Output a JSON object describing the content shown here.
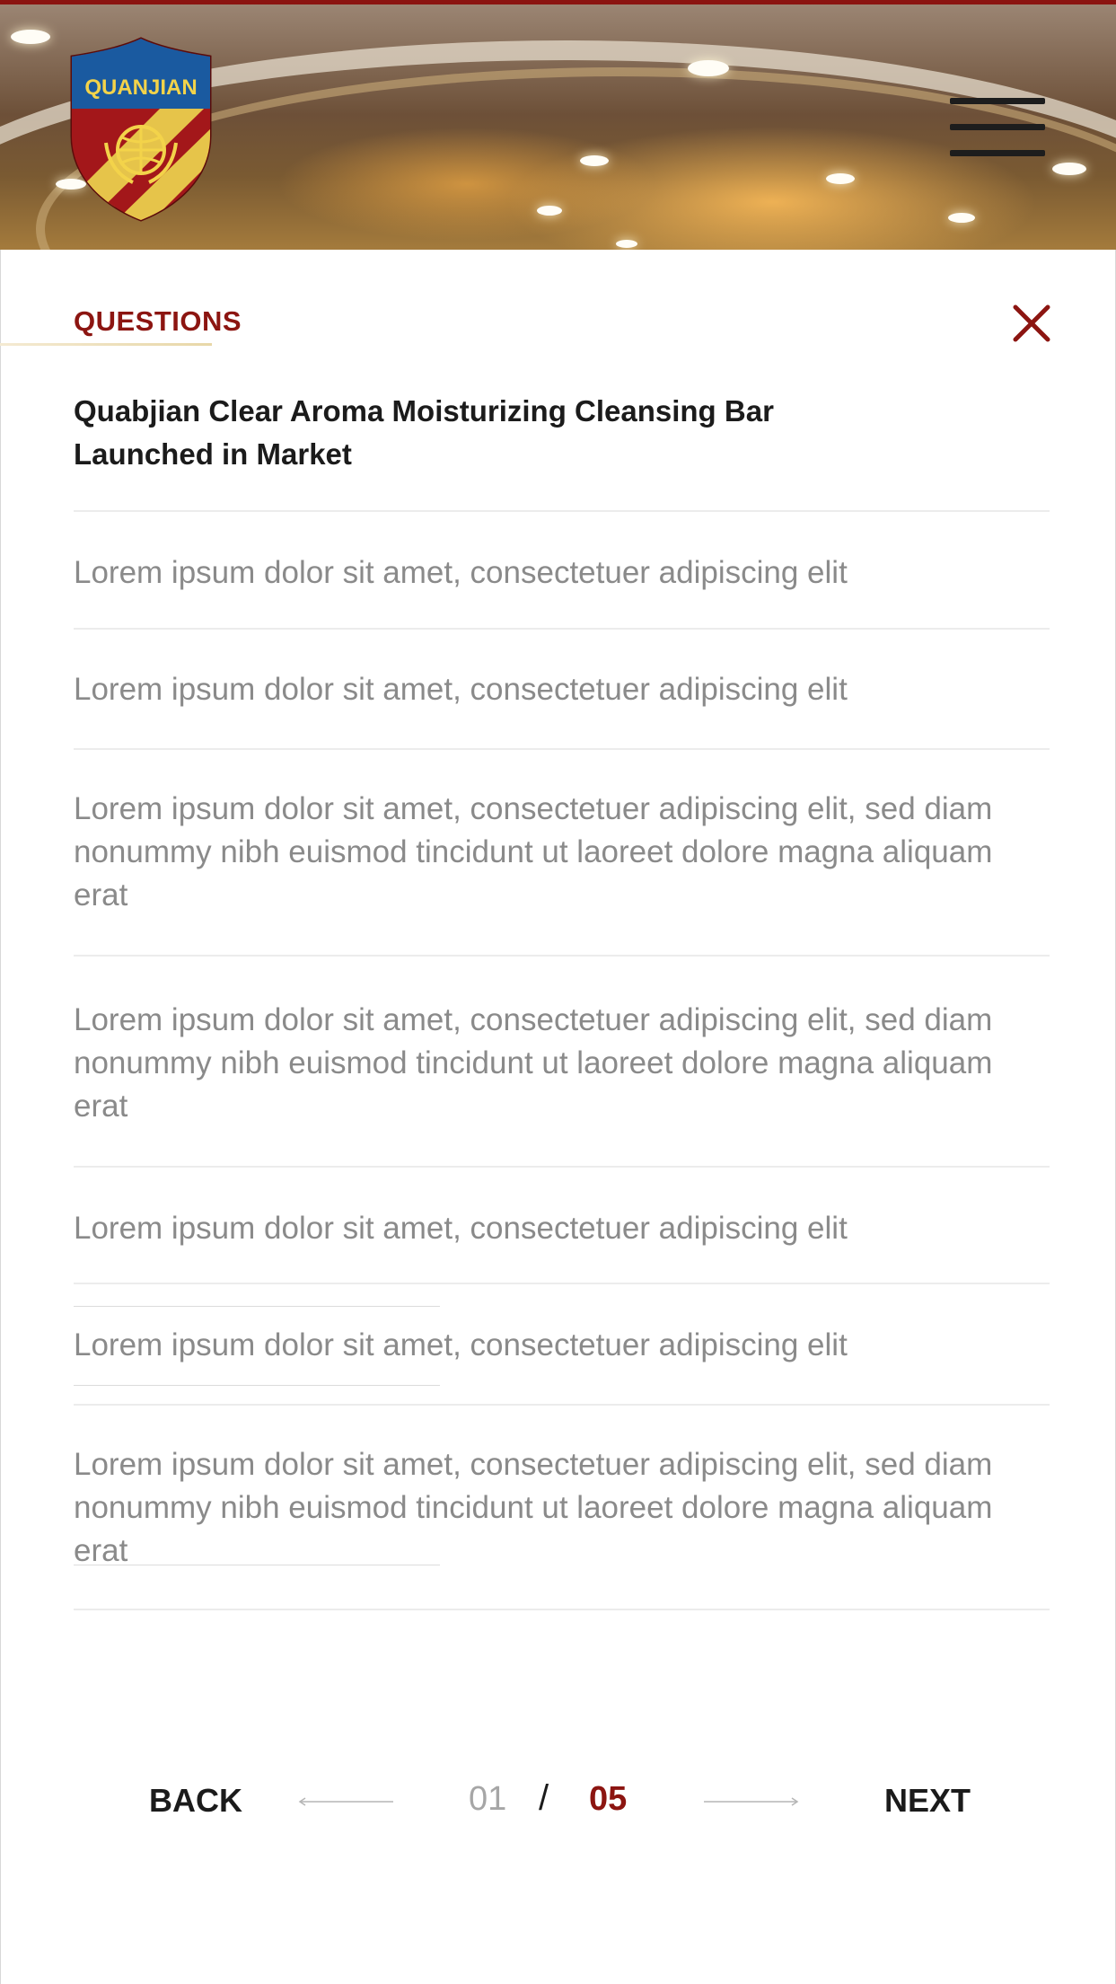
{
  "brand": {
    "logo_text": "QUANJIAN",
    "colors": {
      "primary": "#8c1511",
      "shield_blue": "#1a5aa0",
      "shield_gold": "#e8c23a"
    }
  },
  "header": {
    "menu_icon": "hamburger-menu-icon"
  },
  "panel": {
    "section_title": "QUESTIONS",
    "close_icon": "close-icon",
    "heading": "Quabjian Clear Aroma Moisturizing Cleansing Bar Launched in Market",
    "items": [
      "Lorem ipsum dolor sit amet, consectetuer adipiscing elit",
      "Lorem ipsum dolor sit amet, consectetuer adipiscing elit",
      "Lorem ipsum dolor sit amet, consectetuer adipiscing elit, sed diam nonummy nibh euismod tincidunt ut laoreet dolore magna aliquam erat",
      "Lorem ipsum dolor sit amet, consectetuer adipiscing elit, sed diam nonummy nibh euismod tincidunt ut laoreet dolore magna aliquam erat",
      "Lorem ipsum dolor sit amet, consectetuer adipiscing elit",
      "Lorem ipsum dolor sit amet, consectetuer adipiscing elit",
      "Lorem ipsum dolor sit amet, consectetuer adipiscing elit, sed diam nonummy nibh euismod tincidunt ut laoreet dolore magna aliquam erat"
    ]
  },
  "pagination": {
    "back_label": "BACK",
    "next_label": "NEXT",
    "current": "01",
    "separator": "/",
    "total": "05",
    "prev_icon": "arrow-left-icon",
    "next_icon": "arrow-right-icon"
  }
}
